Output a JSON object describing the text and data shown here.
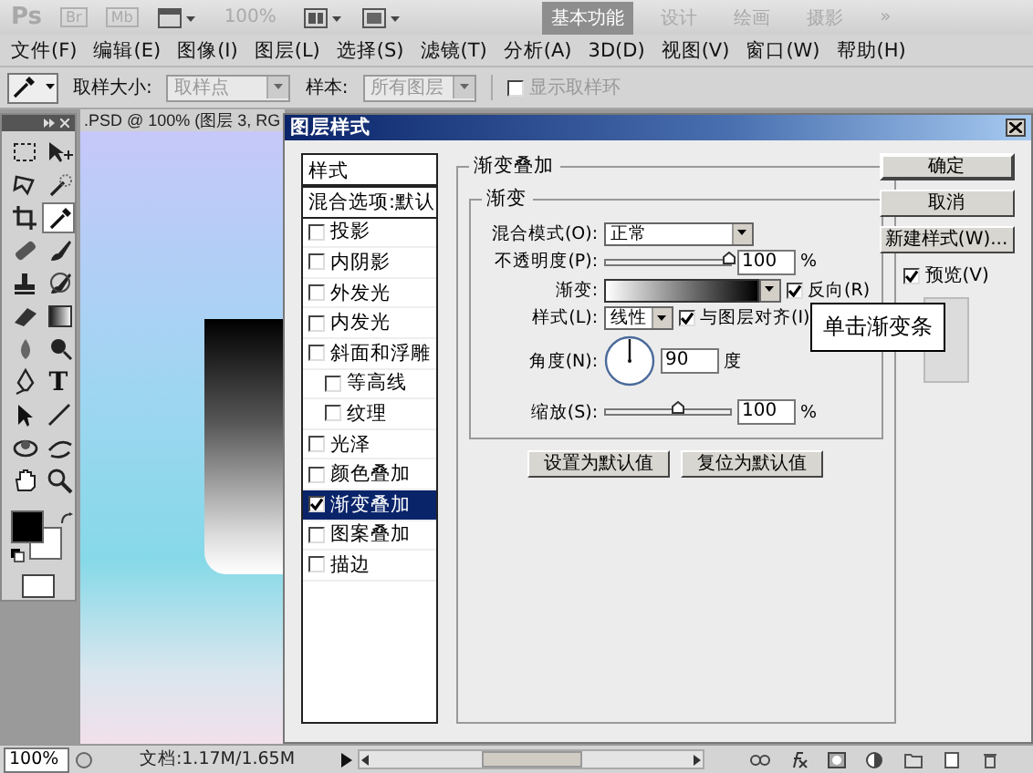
{
  "app_bar": {
    "logo": "Ps",
    "bridge": "Br",
    "mini_bridge": "Mb",
    "zoom": "100%",
    "more": "»",
    "workspaces": [
      {
        "label": "基本功能",
        "selected": true
      },
      {
        "label": "设计",
        "selected": false
      },
      {
        "label": "绘画",
        "selected": false
      },
      {
        "label": "摄影",
        "selected": false
      }
    ]
  },
  "menu": [
    "文件(F)",
    "编辑(E)",
    "图像(I)",
    "图层(L)",
    "选择(S)",
    "滤镜(T)",
    "分析(A)",
    "3D(D)",
    "视图(V)",
    "窗口(W)",
    "帮助(H)"
  ],
  "options_bar": {
    "sample_size_label": "取样大小:",
    "sample_size": "取样点",
    "sample_label": "样本:",
    "sample": "所有图层",
    "show_ring": {
      "label": "显示取样环",
      "checked": false
    }
  },
  "toolbox": {
    "tools": [
      {
        "kind": "marquee",
        "selected": false
      },
      {
        "kind": "move",
        "selected": false
      },
      {
        "kind": "lasso",
        "selected": false
      },
      {
        "kind": "wand",
        "selected": false
      },
      {
        "kind": "crop",
        "selected": false
      },
      {
        "kind": "eyedropper",
        "selected": true
      },
      {
        "kind": "bandage",
        "selected": false
      },
      {
        "kind": "brush",
        "selected": false
      },
      {
        "kind": "stamp",
        "selected": false
      },
      {
        "kind": "history",
        "selected": false
      },
      {
        "kind": "eraser",
        "selected": false
      },
      {
        "kind": "gradient",
        "selected": false
      },
      {
        "kind": "drop",
        "selected": false
      },
      {
        "kind": "dodge",
        "selected": false
      },
      {
        "kind": "pen",
        "selected": false
      },
      {
        "kind": "type",
        "label": "T",
        "selected": false
      },
      {
        "kind": "arrow",
        "selected": false
      },
      {
        "kind": "line",
        "selected": false
      },
      {
        "kind": "rotate3d",
        "selected": false
      },
      {
        "kind": "orbit3d",
        "selected": false
      },
      {
        "kind": "hand",
        "selected": false
      },
      {
        "kind": "zoom",
        "selected": false
      }
    ]
  },
  "document": {
    "tab": ".PSD @ 100% (图层 3, RG"
  },
  "dialog": {
    "title": "图层样式",
    "styles_header": "样式",
    "styles": [
      {
        "label": "混合选项:默认",
        "kind": "plain",
        "selected": false
      },
      {
        "label": "投影",
        "kind": "check",
        "checked": false,
        "selected": false
      },
      {
        "label": "内阴影",
        "kind": "check",
        "checked": false,
        "selected": false
      },
      {
        "label": "外发光",
        "kind": "check",
        "checked": false,
        "selected": false
      },
      {
        "label": "内发光",
        "kind": "check",
        "checked": false,
        "selected": false
      },
      {
        "label": "斜面和浮雕",
        "kind": "check",
        "checked": false,
        "selected": false,
        "children": [
          {
            "label": "等高线",
            "kind": "check",
            "checked": false,
            "selected": false
          },
          {
            "label": "纹理",
            "kind": "check",
            "checked": false,
            "selected": false
          }
        ]
      },
      {
        "label": "光泽",
        "kind": "check",
        "checked": false,
        "selected": false
      },
      {
        "label": "颜色叠加",
        "kind": "check",
        "checked": false,
        "selected": false
      },
      {
        "label": "渐变叠加",
        "kind": "check",
        "checked": true,
        "selected": true
      },
      {
        "label": "图案叠加",
        "kind": "check",
        "checked": false,
        "selected": false
      },
      {
        "label": "描边",
        "kind": "check",
        "checked": false,
        "selected": false
      }
    ],
    "section_title": "渐变叠加",
    "group_title": "渐变",
    "blend_mode": {
      "label": "混合模式(O):",
      "value": "正常"
    },
    "opacity": {
      "label": "不透明度(P):",
      "level": 1.0,
      "value": "100",
      "unit": "%"
    },
    "gradient": {
      "label": "渐变:",
      "reverse": {
        "label": "反向(R)",
        "checked": true
      }
    },
    "style": {
      "label": "样式(L):",
      "value": "线性",
      "align": {
        "label": "与图层对齐(I)",
        "checked": true
      }
    },
    "angle": {
      "label": "角度(N):",
      "value": "90",
      "unit": "度"
    },
    "scale": {
      "label": "缩放(S):",
      "level": 0.6,
      "value": "100",
      "unit": "%"
    },
    "default_buttons": [
      "设置为默认值",
      "复位为默认值"
    ],
    "side_buttons": [
      "确定",
      "取消",
      "新建样式(W)..."
    ],
    "preview": {
      "label": "预览(V)",
      "checked": true
    }
  },
  "callout": "单击渐变条",
  "status_bar": {
    "zoom": "100%",
    "doc_info": "文档:1.17M/1.65M"
  }
}
